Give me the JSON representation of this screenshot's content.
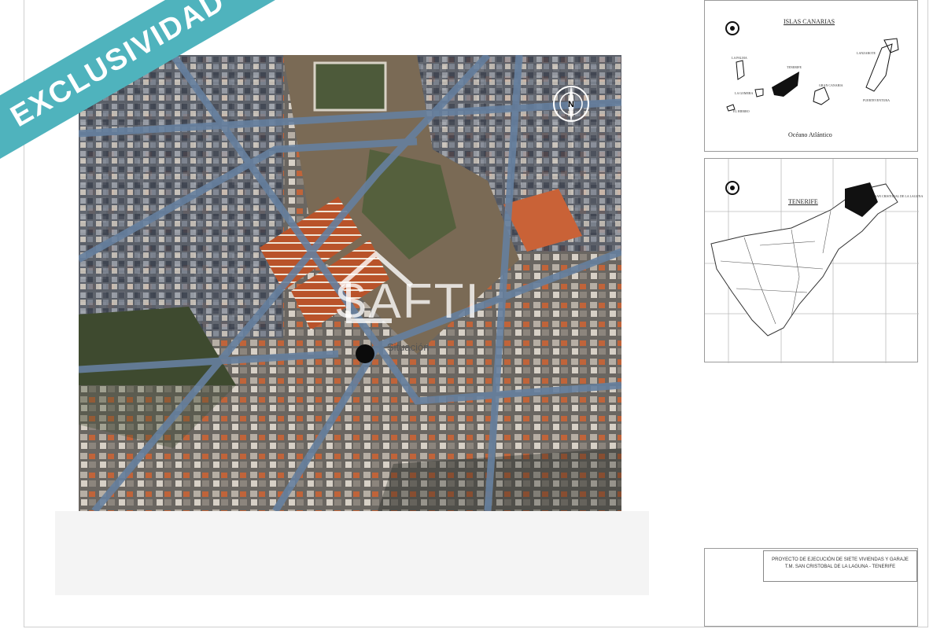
{
  "banner": {
    "text": "EXCLUSIVIDAD",
    "color": "#4fb3bd"
  },
  "aerial": {
    "site_label": "Situación",
    "watermark": "SAFTI",
    "compass_letter": "N"
  },
  "inset_canarias": {
    "title": "ISLAS CANARIAS",
    "islands": [
      "LA PALMA",
      "TENERIFE",
      "LANZAROTE",
      "GRAN CANARIA",
      "FUERTEVENTURA",
      "LA GOMERA",
      "EL HIERRO"
    ],
    "ocean_label": "Océano   Atlántico"
  },
  "inset_tenerife": {
    "title": "TENERIFE",
    "municipality_label": "SAN CRISTOBAL DE LA LAGUNA"
  },
  "title_block": {
    "line1": "PROYECTO DE EJECUCIÓN DE SIETE VIVIENDAS Y GARAJE",
    "line2": "T.M. SAN CRISTOBAL DE LA LAGUNA - TENERIFE"
  },
  "colors": {
    "roads": "#5b6f8f",
    "roofs": "#c65a2e",
    "vegetation": "#3d4b2e"
  }
}
